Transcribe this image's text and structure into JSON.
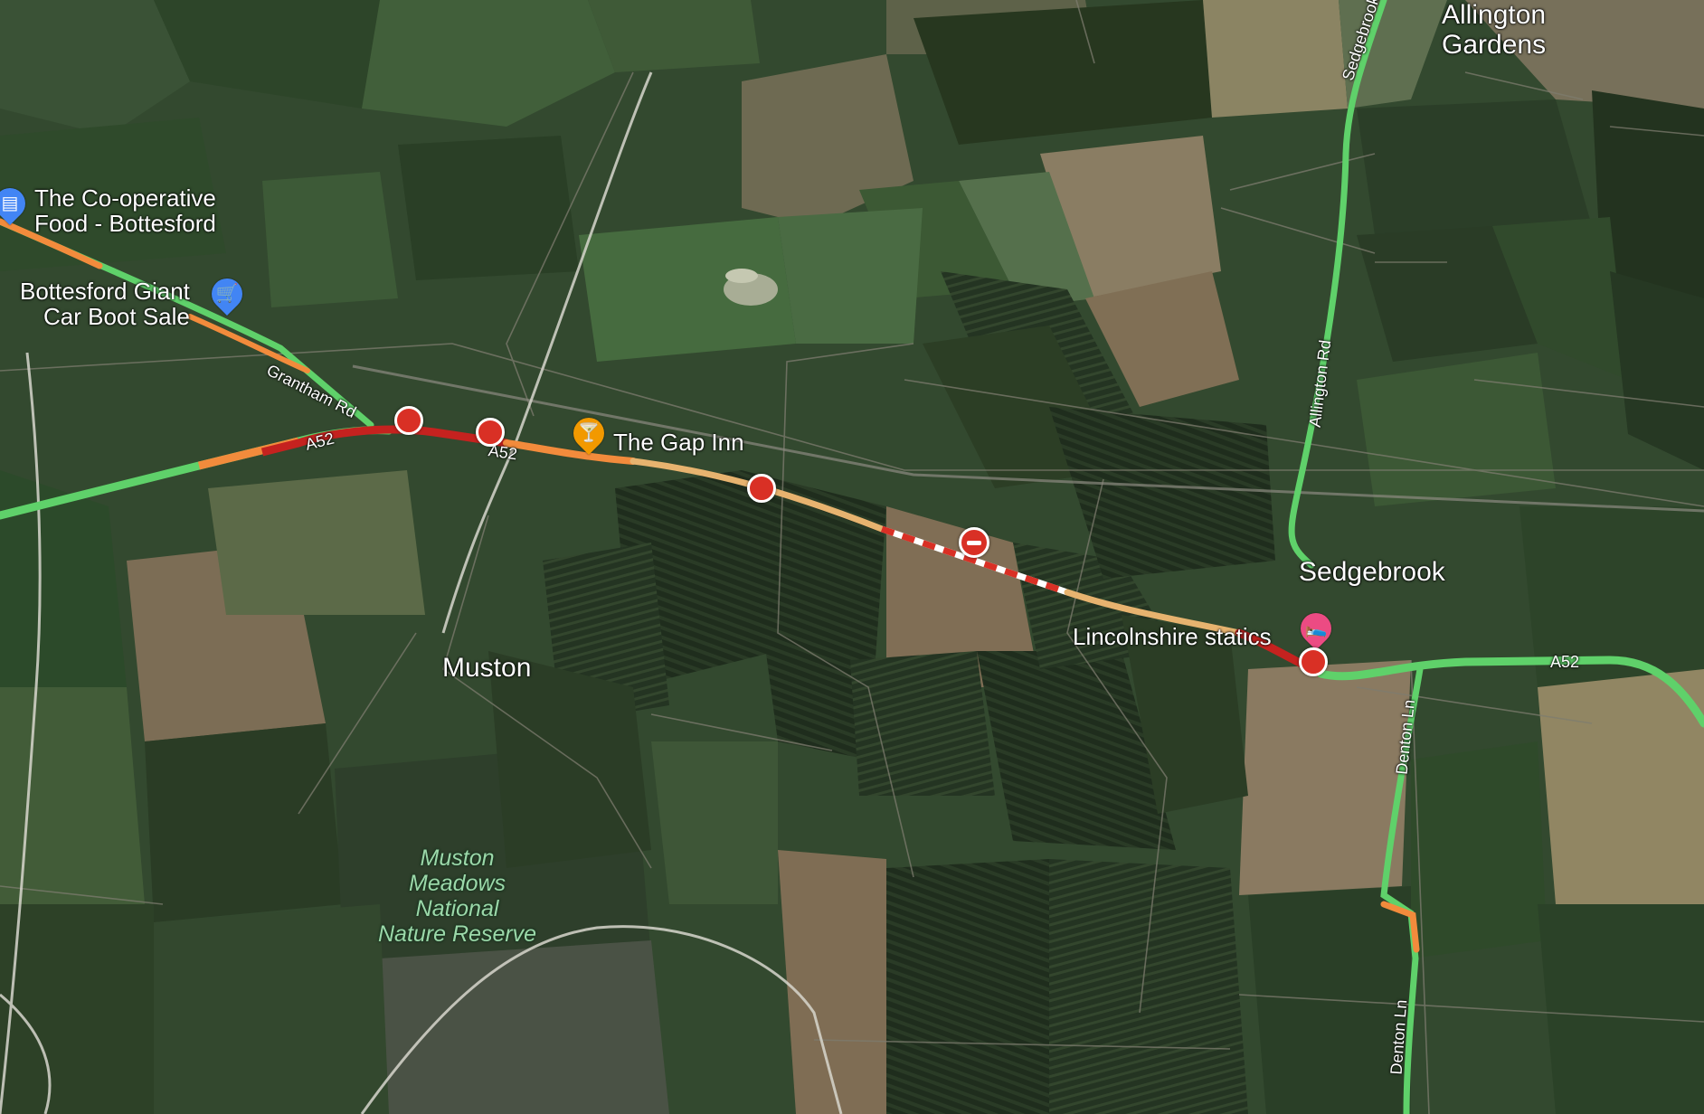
{
  "map": {
    "places": {
      "allington_gardens": "Allington\nGardens",
      "muston": "Muston",
      "sedgebrook": "Sedgebrook"
    },
    "pois": {
      "coop": "The Co-operative\nFood - Bottesford",
      "car_boot": "Bottesford Giant\nCar Boot Sale",
      "gap_inn": "The Gap Inn",
      "lincs_statics": "Lincolnshire statics"
    },
    "park": [
      "Muston",
      "Meadows",
      "National",
      "Nature Reserve"
    ],
    "roads": {
      "a52": "A52",
      "grantham_rd": "Grantham Rd",
      "sedgebrook_rd": "Sedgebrook",
      "allington_rd": "Allington Rd",
      "denton_ln": "Denton Ln"
    },
    "traffic_colors": {
      "free_flow": "#5fd16a",
      "slow": "#f28b3c",
      "heavy": "#c5221f",
      "minor_road": "#e7b36f",
      "closure": "#d93025"
    },
    "icons": {
      "crash": "crash-icon",
      "closure": "road-closed-icon",
      "shop": "shop-icon",
      "cart": "shopping-cart-icon",
      "bar": "cocktail-icon",
      "lodging": "bed-icon"
    }
  }
}
